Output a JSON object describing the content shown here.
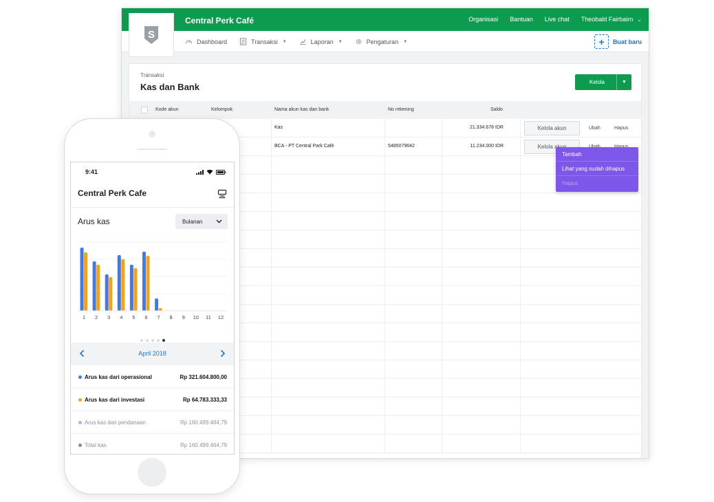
{
  "desktop": {
    "app_title": "Central Perk Café",
    "top_links": [
      "Organisasi",
      "Bantuan",
      "Live chat"
    ],
    "user_name": "Theobald Fairbairn",
    "nav": [
      {
        "label": "Dashboard",
        "icon": "dashboard-icon",
        "has_caret": false
      },
      {
        "label": "Transaksi",
        "icon": "transaction-icon",
        "has_caret": true
      },
      {
        "label": "Laporan",
        "icon": "report-icon",
        "has_caret": true
      },
      {
        "label": "Pengaturan",
        "icon": "gear-icon",
        "has_caret": true
      }
    ],
    "create_label": "Buat baru",
    "breadcrumb": "Transaksi",
    "page_title": "Kas dan Bank",
    "manage_label": "Kelola",
    "dropdown": [
      "Tambah",
      "Lihat yang sudah dihapus",
      "Hapus"
    ],
    "columns": [
      "Kode akun",
      "Kelompok",
      "Nama akun kas dan bank",
      "No rekening",
      "Saldo"
    ],
    "rows": [
      {
        "name": "Kas",
        "account_no": "",
        "saldo": "21.334.678 IDR",
        "manage": "Kelola akun",
        "edit": "Ubah",
        "delete": "Hapus"
      },
      {
        "name": "BCA - PT Central Park Café",
        "account_no": "5485079642",
        "saldo": "11.234.000 IDR",
        "manage": "Kelola akun",
        "edit": "Ubah",
        "delete": "Hapus"
      }
    ],
    "accent_green": "#0d9c4f",
    "accent_purple": "#7c57e9",
    "link_blue": "#1a73d9"
  },
  "phone": {
    "time": "9:41",
    "app_title": "Central Perk Cafe",
    "section_title": "Arus kas",
    "period_select": "Bulanan",
    "month_label": "April 2018",
    "carousel_dots": 5,
    "carousel_active": 5,
    "summary": [
      {
        "label": "Arus kas dari operasional",
        "value": "Rp 321.604.800,00",
        "color": "#3b7bf2",
        "style": "bold"
      },
      {
        "label": "Arus kas dari investasi",
        "value": "Rp 64.783.333,33",
        "color": "#f5a21a",
        "style": "bold"
      },
      {
        "label": "Arus kas dari pendanaan",
        "value": "Rp 160.499.464,79",
        "color": "#b9a7f3",
        "style": "muted"
      },
      {
        "label": "Total kas",
        "value": "Rp 160.499.464,79",
        "color": "#888c91",
        "style": "muted"
      }
    ]
  },
  "chart_data": {
    "type": "bar",
    "categories": [
      "1",
      "2",
      "3",
      "4",
      "5",
      "6",
      "7",
      "8",
      "9",
      "10",
      "11",
      "12"
    ],
    "series": [
      {
        "color": "#3b7bf2",
        "values": [
          92,
          72,
          53,
          81,
          67,
          86,
          18,
          0,
          0,
          0,
          0,
          0
        ]
      },
      {
        "color": "#f5a21a",
        "values": [
          85,
          67,
          49,
          75,
          62,
          80,
          4,
          0,
          0,
          0,
          0,
          0
        ]
      }
    ],
    "ylim": [
      0,
      100
    ],
    "grid": true
  }
}
